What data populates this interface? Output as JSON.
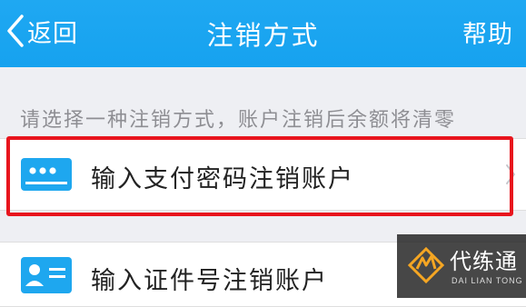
{
  "header": {
    "back_label": "返回",
    "title": "注销方式",
    "help_label": "帮助"
  },
  "hint": "请选择一种注销方式，账户注销后余额将清零",
  "options": [
    {
      "label": "输入支付密码注销账户",
      "icon": "password-card-icon",
      "highlighted": true
    },
    {
      "label": "输入证件号注销账户",
      "icon": "id-card-icon",
      "highlighted": false
    }
  ],
  "watermark": {
    "text": "代练通",
    "subtext": "DAI LIAN TONG"
  },
  "colors": {
    "header_bg": "#16a2ef",
    "highlight": "#e8151d",
    "icon_blue": "#1ea7ef"
  }
}
